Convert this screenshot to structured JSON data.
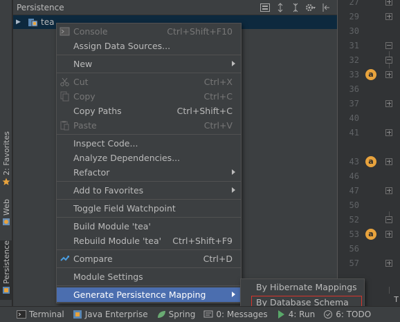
{
  "panel": {
    "title": "Persistence",
    "tree_item": "tea"
  },
  "left_tabs": {
    "favorites": "2: Favorites",
    "web": "Web",
    "persistence": "Persistence"
  },
  "gutter": {
    "lines": [
      "27",
      "29",
      "30",
      "31",
      "32",
      "33",
      "36",
      "37",
      "40",
      "41",
      "43",
      "46",
      "47",
      "50",
      "52",
      "53",
      "56",
      "57"
    ],
    "annotation_letter": "a"
  },
  "menu": {
    "console": {
      "label": "Console",
      "shortcut": "Ctrl+Shift+F10"
    },
    "assign_data_sources": {
      "label": "Assign Data Sources..."
    },
    "new": {
      "label": "New"
    },
    "cut": {
      "label": "Cut",
      "shortcut": "Ctrl+X"
    },
    "copy": {
      "label": "Copy",
      "shortcut": "Ctrl+C"
    },
    "copy_paths": {
      "label": "Copy Paths",
      "shortcut": "Ctrl+Shift+C"
    },
    "paste": {
      "label": "Paste",
      "shortcut": "Ctrl+V"
    },
    "inspect_code": {
      "label": "Inspect Code..."
    },
    "analyze_dependencies": {
      "label": "Analyze Dependencies..."
    },
    "refactor": {
      "label": "Refactor"
    },
    "add_to_favorites": {
      "label": "Add to Favorites"
    },
    "toggle_field_watchpoint": {
      "label": "Toggle Field Watchpoint"
    },
    "build_module": {
      "label": "Build Module 'tea'"
    },
    "rebuild_module": {
      "label": "Rebuild Module 'tea'",
      "shortcut": "Ctrl+Shift+F9"
    },
    "compare": {
      "label": "Compare",
      "shortcut": "Ctrl+D"
    },
    "module_settings": {
      "label": "Module Settings"
    },
    "generate_persistence_mapping": {
      "label": "Generate Persistence Mapping"
    }
  },
  "submenu": {
    "by_hibernate_mappings": "By Hibernate Mappings",
    "by_database_schema": "By Database Schema"
  },
  "bottom_bar": {
    "terminal": "Terminal",
    "java_enterprise": "Java Enterprise",
    "spring": "Spring",
    "messages": "0: Messages",
    "run": "4: Run",
    "todo": "6: TODO",
    "right_letter": "T"
  },
  "colors": {
    "menu_highlight": "#4b6eaf",
    "annotation": "#e8a33d",
    "red_outline": "#d9342b",
    "tree_selection": "#0d293e"
  }
}
